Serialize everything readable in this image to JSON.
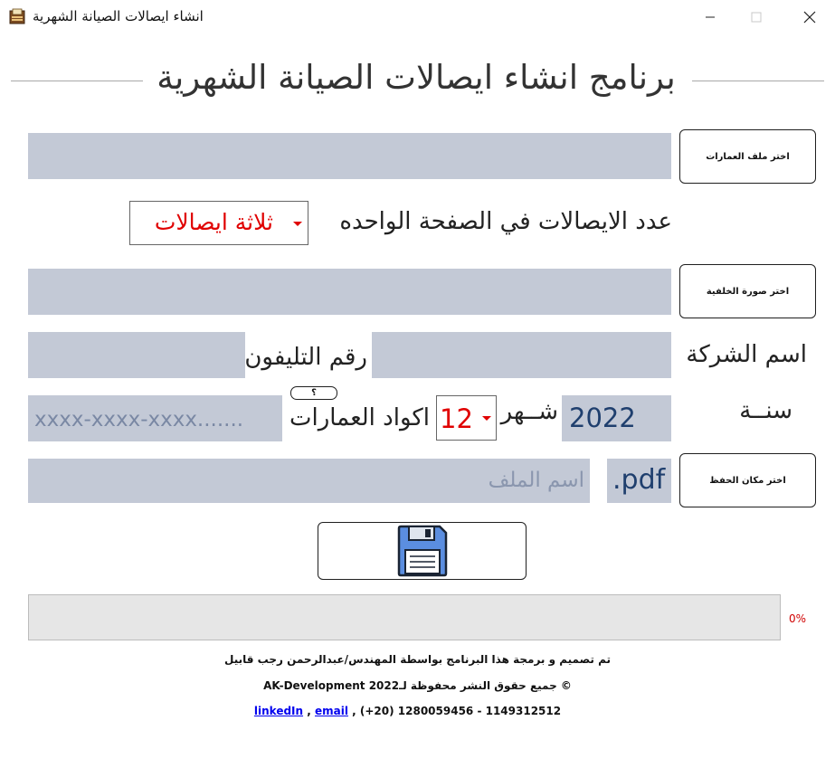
{
  "window": {
    "title": "انشاء ايصالات الصيانة الشهرية"
  },
  "header": {
    "title": "برنامج انشاء ايصالات الصيانة الشهرية"
  },
  "buildings": {
    "button_label": "اختر ملف العمارات",
    "value": ""
  },
  "receipts_per_page": {
    "label": "عدد الايصالات في الصفحة الواحده",
    "selected": "ثلاثة ايصالات"
  },
  "background": {
    "button_label": "اختر صورة الخلفية",
    "value": ""
  },
  "company": {
    "label": "اسم الشركة",
    "value": ""
  },
  "phone": {
    "label": "رقم التليفون",
    "value": ""
  },
  "year": {
    "label": "سنــة",
    "value": "2022"
  },
  "month": {
    "label": "شــهر",
    "selected": "12"
  },
  "codes": {
    "label": "اكواد العمارات",
    "help_label": "؟",
    "placeholder": "xxxx-xxxx-xxxx......."
  },
  "save": {
    "button_label": "اختر مكان الحفظ",
    "extension": ".pdf",
    "filename_placeholder": "اسم الملف"
  },
  "progress": {
    "value": 0,
    "text": "0%"
  },
  "footer": {
    "credit": "تم تصميم و برمجة هذا البرنامج بواسطة المهندس/عبدالرحمن رجب قابيل",
    "copyright": "© جميع حقوق النشر محفوظة لـAK-Development 2022",
    "linkedin": "linkedIn",
    "sep1": " , ",
    "email": "email",
    "phones": " , (+20) 1280059456 - 1149312512"
  },
  "icons": {
    "app": "receipt-app-icon",
    "save": "floppy-disk-icon"
  },
  "colors": {
    "field": "#c3c9d6",
    "accent_red": "#e00000",
    "value_blue": "#1f3f6e",
    "placeholder": "#7a88a4"
  }
}
